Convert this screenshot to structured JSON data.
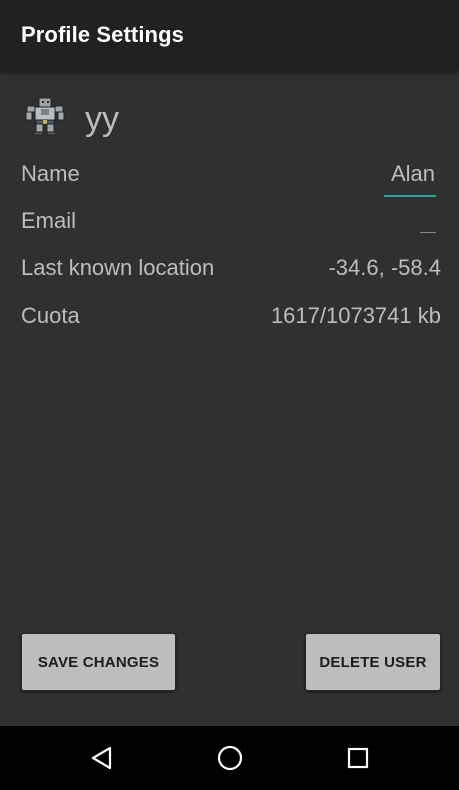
{
  "toolbar": {
    "title": "Profile Settings"
  },
  "profile": {
    "avatar_icon": "character-avatar-icon",
    "username": "yy"
  },
  "fields": {
    "name": {
      "label": "Name",
      "value": "Alan"
    },
    "email": {
      "label": "Email",
      "value": ""
    },
    "location": {
      "label": "Last known location",
      "value": "-34.6, -58.4"
    },
    "quota": {
      "label": "Cuota",
      "value": "1617/1073741 kb"
    }
  },
  "actions": {
    "save_label": "SAVE CHANGES",
    "delete_label": "DELETE USER"
  },
  "navigation": {
    "back_icon": "back-triangle-icon",
    "home_icon": "home-circle-icon",
    "recents_icon": "recents-square-icon"
  },
  "colors": {
    "toolbar_bg": "#212121",
    "content_bg": "#303030",
    "accent": "#1fa89a",
    "button_bg": "#bdbdbd",
    "nav_bg": "#000000"
  }
}
